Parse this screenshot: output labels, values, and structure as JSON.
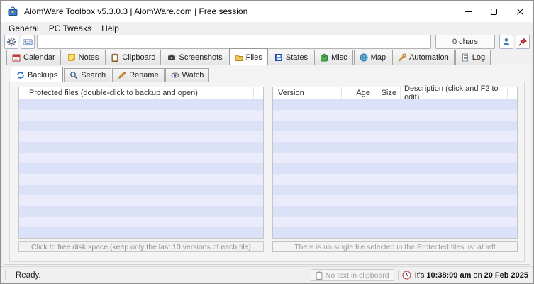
{
  "window": {
    "title": "AlomWare Toolbox v5.3.0.3  |  AlomWare.com  |  Free session"
  },
  "menu": {
    "items": [
      {
        "label": "General"
      },
      {
        "label": "PC Tweaks"
      },
      {
        "label": "Help"
      }
    ]
  },
  "toolbar": {
    "command_input": {
      "value": "",
      "placeholder": ""
    },
    "char_count": "0 chars"
  },
  "tabs": {
    "items": [
      {
        "label": "Calendar",
        "icon": "calendar-icon",
        "selected": false
      },
      {
        "label": "Notes",
        "icon": "notes-icon",
        "selected": false
      },
      {
        "label": "Clipboard",
        "icon": "clipboard-icon",
        "selected": false
      },
      {
        "label": "Screenshots",
        "icon": "screenshots-icon",
        "selected": false
      },
      {
        "label": "Files",
        "icon": "files-icon",
        "selected": true
      },
      {
        "label": "States",
        "icon": "states-icon",
        "selected": false
      },
      {
        "label": "Misc",
        "icon": "misc-icon",
        "selected": false
      },
      {
        "label": "Map",
        "icon": "map-icon",
        "selected": false
      },
      {
        "label": "Automation",
        "icon": "automation-icon",
        "selected": false
      },
      {
        "label": "Log",
        "icon": "log-icon",
        "selected": false
      }
    ]
  },
  "subtabs": {
    "items": [
      {
        "label": "Backups",
        "icon": "backups-icon",
        "selected": true
      },
      {
        "label": "Search",
        "icon": "search-icon",
        "selected": false
      },
      {
        "label": "Rename",
        "icon": "rename-icon",
        "selected": false
      },
      {
        "label": "Watch",
        "icon": "watch-icon",
        "selected": false
      }
    ]
  },
  "backups_page": {
    "protected_list": {
      "header": "Protected files  (double-click to backup and open)",
      "rows": [],
      "footer_button": "Click to free disk space (keep only the last 10 versions of each file)"
    },
    "versions_list": {
      "columns": [
        "Version",
        "Age",
        "Size",
        "Description  (click and F2 to edit)"
      ],
      "rows": [],
      "footer_note": "There is no single file selected in the Protected files list at left"
    }
  },
  "statusbar": {
    "ready": "Ready.",
    "clipboard_status": "No text in clipboard",
    "time_prefix": "It's",
    "time": "10:38:09 am",
    "time_joiner": "on",
    "date": "20 Feb 2025"
  },
  "colors": {
    "titlebar_bg": "#ffffff",
    "window_bg": "#f0f0f0",
    "row_stripe_a": "#dbe1f6",
    "row_stripe_b": "#eaecfb",
    "pin_red": "#d64040",
    "disabled_text": "#9a9a9a"
  }
}
